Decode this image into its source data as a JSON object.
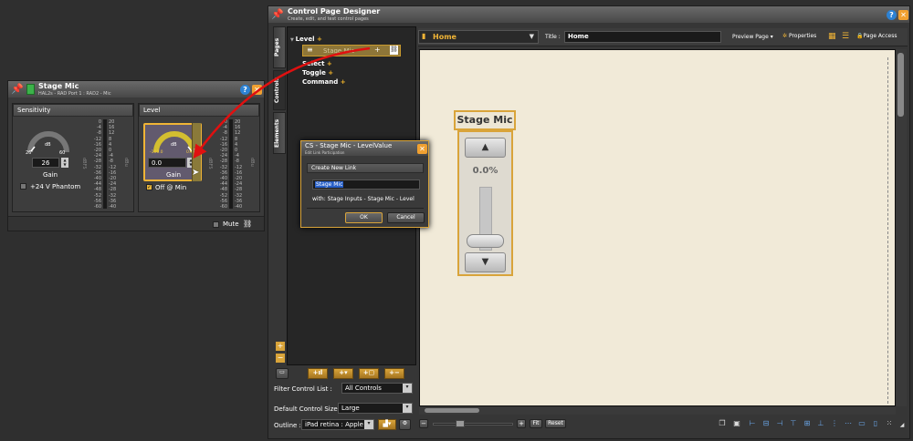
{
  "stage_mic_window": {
    "title": "Stage Mic",
    "subtitle": "HAL2s - RAD Port 1 : RAD2 - Mic",
    "sensitivity": {
      "header": "Sensitivity",
      "gain_value": "26",
      "dial_min": "26",
      "dial_max": "60",
      "unit": "dB",
      "label": "Gain",
      "phantom_label": "+24 V Phantom"
    },
    "level": {
      "header": "Level",
      "gain_value": "0.0",
      "dial_min": "-100.0",
      "dial_max": "0.0",
      "unit": "dB",
      "label": "Gain",
      "off_at_min_label": "Off @ Min"
    },
    "meter_scale_left": [
      "0",
      "-4",
      "-8",
      "-12",
      "-16",
      "-20",
      "-24",
      "-28",
      "-32",
      "-36",
      "-40",
      "-44",
      "-48",
      "-52",
      "-56",
      "-60"
    ],
    "meter_scale_right": [
      "20",
      "16",
      "12",
      "8",
      "4",
      "0",
      "-4",
      "-8",
      "-12",
      "-16",
      "-20",
      "-24",
      "-28",
      "-32",
      "-36",
      "-40"
    ],
    "meter_unit_left": "dBFS",
    "meter_unit_right": "dBu",
    "mute_label": "Mute"
  },
  "cpd_window": {
    "title": "Control Page Designer",
    "subtitle": "Create, edit, and test control pages",
    "side_tabs": [
      "Pages",
      "Controls",
      "Elements"
    ],
    "tree": {
      "level": "Level",
      "selected_item": "Stage Mic",
      "select": "Select",
      "toggle": "Toggle",
      "command": "Command"
    },
    "filter_label": "Filter Control List :",
    "filter_value": "All Controls",
    "default_size_label": "Default Control Size :",
    "default_size_value": "Large",
    "outline_label": "Outline :",
    "outline_value": "iPad retina : Apple",
    "page_select": "Home",
    "title_label": "Title :",
    "title_value": "Home",
    "preview_page": "Preview Page",
    "properties": "Properties",
    "page_access": "Page Access",
    "fit": "Fit",
    "reset": "Reset",
    "control": {
      "title": "Stage Mic",
      "value": "0.0%"
    }
  },
  "dialog": {
    "title": "CS - Stage Mic - LevelValue",
    "subtitle": "Edit Link Participation",
    "section": "Create New Link",
    "input_value": "Stage Mic",
    "with_text": "with: Stage Inputs - Stage Mic - Level",
    "ok": "OK",
    "cancel": "Cancel"
  },
  "colors": {
    "accent": "#f3b52a",
    "canvas": "#f1ead8",
    "arrow": "#e01010",
    "help": "#2d82d4"
  }
}
